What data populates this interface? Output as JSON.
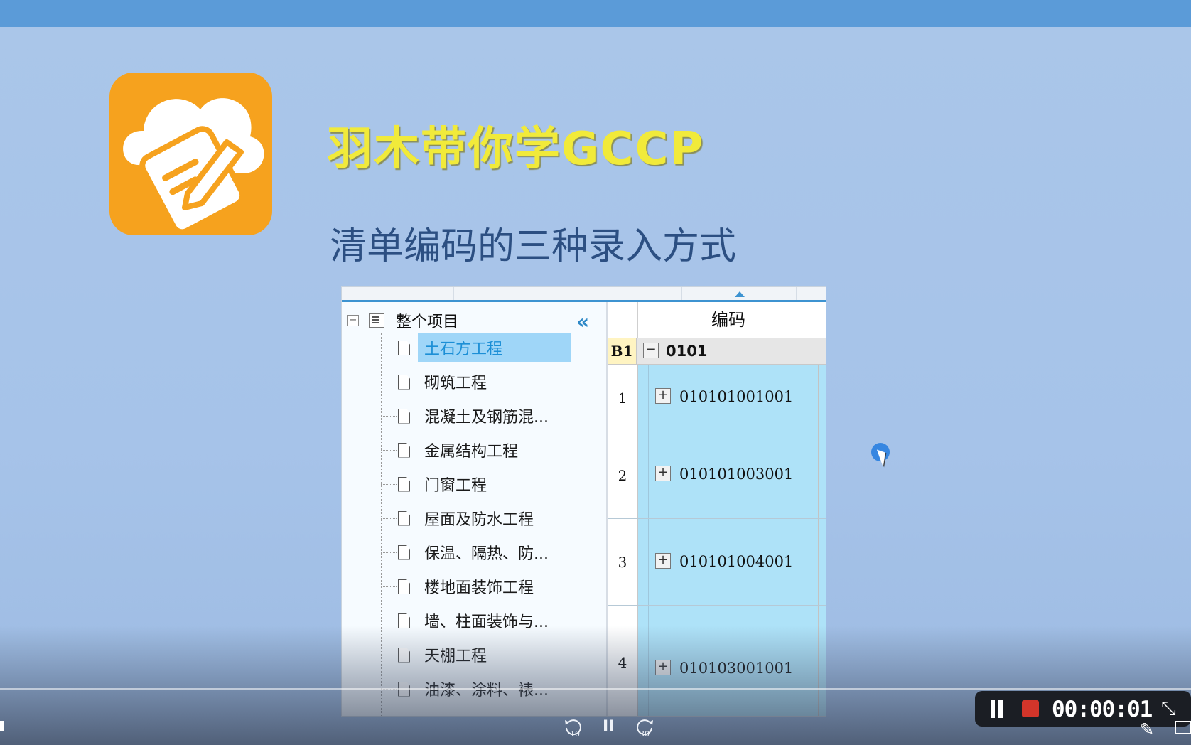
{
  "slide": {
    "title": "羽木带你学GCCP",
    "subtitle": "清单编码的三种录入方式"
  },
  "tree": {
    "root_label": "整个项目",
    "items": [
      {
        "label": "土石方工程",
        "selected": true
      },
      {
        "label": "砌筑工程"
      },
      {
        "label": "混凝土及钢筋混..."
      },
      {
        "label": "金属结构工程"
      },
      {
        "label": "门窗工程"
      },
      {
        "label": "屋面及防水工程"
      },
      {
        "label": "保温、隔热、防..."
      },
      {
        "label": "楼地面装饰工程"
      },
      {
        "label": "墙、柱面装饰与..."
      },
      {
        "label": "天棚工程"
      },
      {
        "label": "油漆、涂料、裱..."
      }
    ]
  },
  "grid": {
    "header": "编码",
    "group": {
      "tag": "B1",
      "code": "0101",
      "expander": "−"
    },
    "rows": [
      {
        "num": "1",
        "code": "010101001001",
        "expander": "+"
      },
      {
        "num": "2",
        "code": "010101003001",
        "expander": "+"
      },
      {
        "num": "3",
        "code": "010101004001",
        "expander": "+"
      },
      {
        "num": "4",
        "code": "010103001001",
        "expander": "+"
      }
    ]
  },
  "player": {
    "rewind_label": "10",
    "forward_label": "30",
    "pause_symbol": "II",
    "recording_time": "00:00:01"
  },
  "colors": {
    "topbar": "#5b9bd8",
    "logo_bg": "#f6a21e",
    "title": "#f1ea3a",
    "subtitle": "#2c4f82",
    "selected_item": "#9fd6f8",
    "code_cells": "#aee2f8",
    "recording": "#d3352a"
  }
}
